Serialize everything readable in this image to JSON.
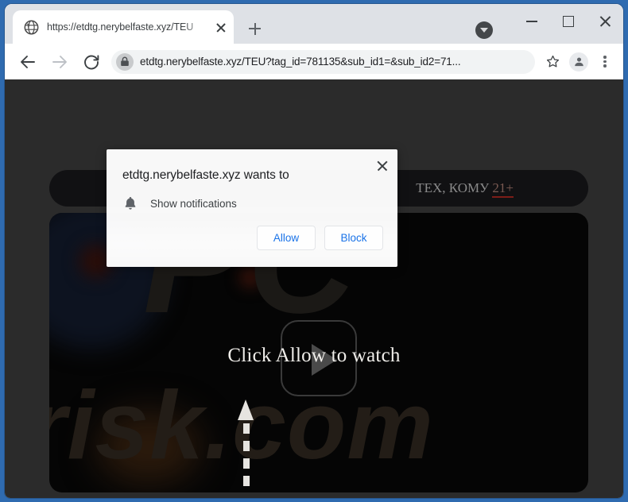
{
  "window": {
    "controls": {
      "downloads_label": "downloads-indicator",
      "minimize_label": "Minimize",
      "maximize_label": "Maximize",
      "close_label": "Close"
    }
  },
  "tabstrip": {
    "tab": {
      "title": "https://etdtg.nerybelfaste.xyz/TEU",
      "favicon": "globe-icon",
      "close_label": "Close tab"
    },
    "new_tab_label": "New Tab"
  },
  "toolbar": {
    "back_label": "Back",
    "forward_label": "Forward",
    "reload_label": "Reload",
    "lock_icon": "lock-icon",
    "url": "etdtg.nerybelfaste.xyz/TEU?tag_id=781135&sub_id1=&sub_id2=71...",
    "bookmark_label": "Bookmark this tab",
    "profile_label": "Profile",
    "menu_label": "Customize and control Google Chrome"
  },
  "page": {
    "banner_text_prefix": "ТЕХ, КОМУ ",
    "banner_age": "21+",
    "watermark_top": "PC",
    "watermark_bottom": "risk.com",
    "cta_text": "Click Allow to watch",
    "play_button_label": "play-button",
    "arrow_label": "arrow-pointing-up"
  },
  "permission_dialog": {
    "title": "etdtg.nerybelfaste.xyz wants to",
    "permission_icon": "bell-icon",
    "permission_text": "Show notifications",
    "allow_label": "Allow",
    "block_label": "Block",
    "close_label": "Close"
  },
  "colors": {
    "frame": "#2f6bb0",
    "tabstrip": "#dee1e6",
    "toolbar": "#ffffff",
    "omnibox": "#f1f3f4",
    "page_bg": "#2b2b2b",
    "card_bg": "#050505",
    "accent_blue": "#1a73e8",
    "age_underline": "#7d1d18"
  }
}
